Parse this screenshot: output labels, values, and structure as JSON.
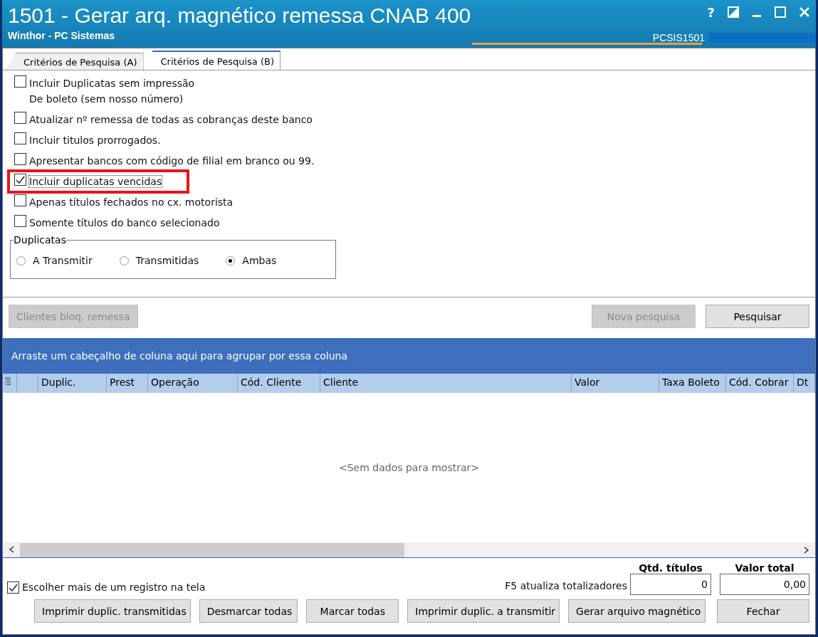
{
  "window": {
    "title": "1501 - Gerar arq. magnético remessa CNAB 400",
    "subtitle": "Winthor - PC Sistemas",
    "code": "PCSIS1501",
    "controls": [
      "?"
    ]
  },
  "tabs": [
    {
      "label": "Critérios de Pesquisa (A)",
      "selected": false
    },
    {
      "label": "Critérios de Pesquisa (B)",
      "selected": true
    }
  ],
  "options": [
    {
      "label": "Incluir Duplicatas sem impressão",
      "label_2": "De boleto (sem nosso número)",
      "checked": false,
      "highlighted": false
    },
    {
      "label": "Atualizar nº remessa de todas as cobranças deste banco",
      "checked": false,
      "highlighted": false
    },
    {
      "label": "Incluir titulos prorrogados.",
      "checked": false,
      "highlighted": false
    },
    {
      "label": "Apresentar bancos com código de filial em branco ou 99.",
      "checked": false,
      "highlighted": false
    },
    {
      "label": "Incluir duplicatas vencidas",
      "checked": true,
      "highlighted": true
    },
    {
      "label": "Apenas títulos fechados no cx. motorista",
      "checked": false,
      "highlighted": false
    },
    {
      "label": "Somente títulos do banco selecionado",
      "checked": false,
      "highlighted": false
    }
  ],
  "duplicatas": {
    "title": "Duplicatas",
    "options": [
      {
        "label": "A Transmitir",
        "selected": false
      },
      {
        "label": "Transmitidas",
        "selected": false
      },
      {
        "label": "Ambas",
        "selected": true
      }
    ]
  },
  "search_buttons": [
    {
      "label": "Clientes bloq. remessa",
      "disabled": true
    },
    {
      "label": "Nova pesquisa",
      "disabled": true
    },
    {
      "label": "Pesquisar",
      "disabled": false
    }
  ],
  "grid": {
    "group_hint": "Arraste um cabeçalho de coluna aqui para agrupar por essa coluna",
    "columns": [
      "Duplic.",
      "Prest",
      "Operação",
      "Cód. Cliente",
      "Cliente",
      "Valor",
      "Taxa Boleto",
      "Cód. Cobrar",
      "Dt"
    ],
    "empty_text": "<Sem dados para mostrar>"
  },
  "multi_select": {
    "label": "Escolher mais de um registro na tela",
    "checked": true
  },
  "totals": {
    "hint": "F5 atualiza totalizadores",
    "count_label": "Qtd. títulos",
    "count": "0",
    "total_label": "Valor total",
    "total": "0,00"
  },
  "buttons": [
    "Imprimir duplic. transmitidas",
    "Desmarcar todas",
    "Marcar todas",
    "Imprimir duplic. a transmitir",
    "Gerar arquivo magnético",
    "Fechar"
  ]
}
